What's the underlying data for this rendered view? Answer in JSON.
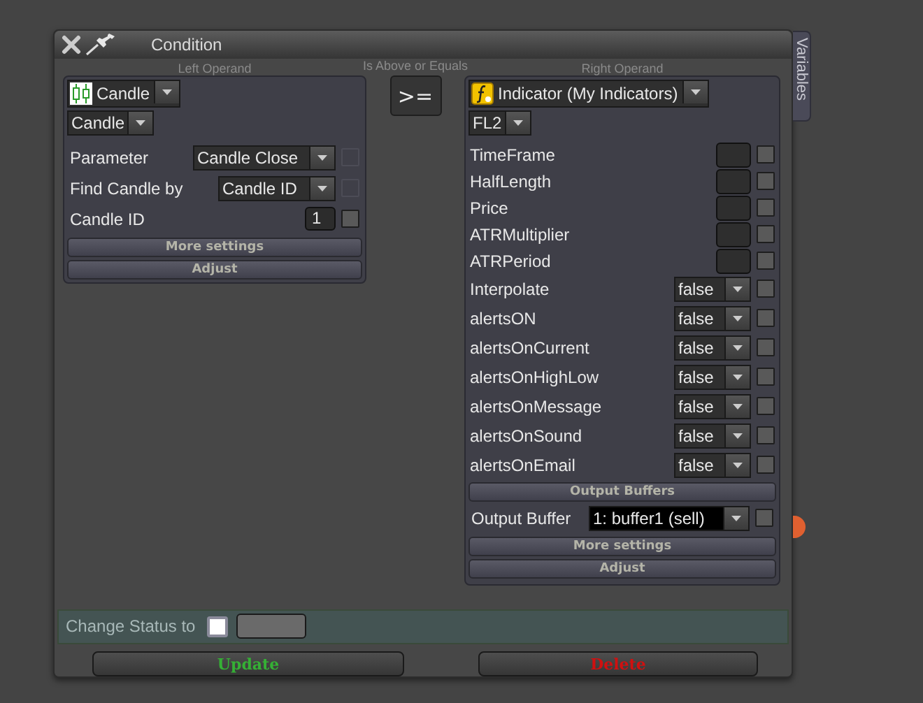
{
  "window": {
    "title": "Condition"
  },
  "variables_tab": {
    "label": "Variables"
  },
  "left_operand": {
    "heading": "Left Operand",
    "type_select": {
      "kind": "candle",
      "value": "Candle"
    },
    "subtype_select": {
      "value": "Candle"
    },
    "params": [
      {
        "kind": "select",
        "label": "Parameter",
        "value": "Candle Close",
        "checkbox": {
          "checked": false,
          "disabled": true
        }
      },
      {
        "kind": "select",
        "label": "Find Candle by",
        "value": "Candle ID",
        "checkbox": {
          "checked": false,
          "disabled": true
        }
      },
      {
        "kind": "number",
        "label": "Candle ID",
        "value": "1",
        "checkbox": {
          "checked": false,
          "disabled": false
        }
      }
    ],
    "buttons": [
      "More settings",
      "Adjust"
    ]
  },
  "operator": {
    "label": "Is Above or Equals",
    "button": ">="
  },
  "right_operand": {
    "heading": "Right Operand",
    "type_select": {
      "kind": "indicator",
      "value": "Indicator (My Indicators)"
    },
    "subtype_select": {
      "value": "FL2"
    },
    "params": [
      {
        "kind": "input",
        "label": "TimeFrame",
        "checkbox": {
          "checked": false,
          "disabled": false
        }
      },
      {
        "kind": "input",
        "label": "HalfLength",
        "checkbox": {
          "checked": false,
          "disabled": false
        }
      },
      {
        "kind": "input",
        "label": "Price",
        "checkbox": {
          "checked": false,
          "disabled": false
        }
      },
      {
        "kind": "input",
        "label": "ATRMultiplier",
        "checkbox": {
          "checked": false,
          "disabled": false
        }
      },
      {
        "kind": "input",
        "label": "ATRPeriod",
        "checkbox": {
          "checked": false,
          "disabled": false
        }
      },
      {
        "kind": "select",
        "label": "Interpolate",
        "value": "false",
        "checkbox": {
          "checked": false,
          "disabled": false
        }
      },
      {
        "kind": "select",
        "label": "alertsON",
        "value": "false",
        "checkbox": {
          "checked": false,
          "disabled": false
        }
      },
      {
        "kind": "select",
        "label": "alertsOnCurrent",
        "value": "false",
        "checkbox": {
          "checked": false,
          "disabled": false
        }
      },
      {
        "kind": "select",
        "label": "alertsOnHighLow",
        "value": "false",
        "checkbox": {
          "checked": false,
          "disabled": false
        }
      },
      {
        "kind": "select",
        "label": "alertsOnMessage",
        "value": "false",
        "checkbox": {
          "checked": false,
          "disabled": false
        }
      },
      {
        "kind": "select",
        "label": "alertsOnSound",
        "value": "false",
        "checkbox": {
          "checked": false,
          "disabled": false
        }
      },
      {
        "kind": "select",
        "label": "alertsOnEmail",
        "value": "false",
        "checkbox": {
          "checked": false,
          "disabled": false
        }
      }
    ],
    "output_buffers": {
      "heading": "Output Buffers",
      "label": "Output Buffer",
      "value": "1: buffer1 (sell)",
      "checkbox": {
        "checked": false,
        "disabled": false
      }
    },
    "buttons": [
      "More settings",
      "Adjust"
    ]
  },
  "status": {
    "label": "Change Status to",
    "checked": false
  },
  "actions": [
    {
      "kind": "update",
      "label": "Update"
    },
    {
      "kind": "delete",
      "label": "Delete"
    }
  ]
}
